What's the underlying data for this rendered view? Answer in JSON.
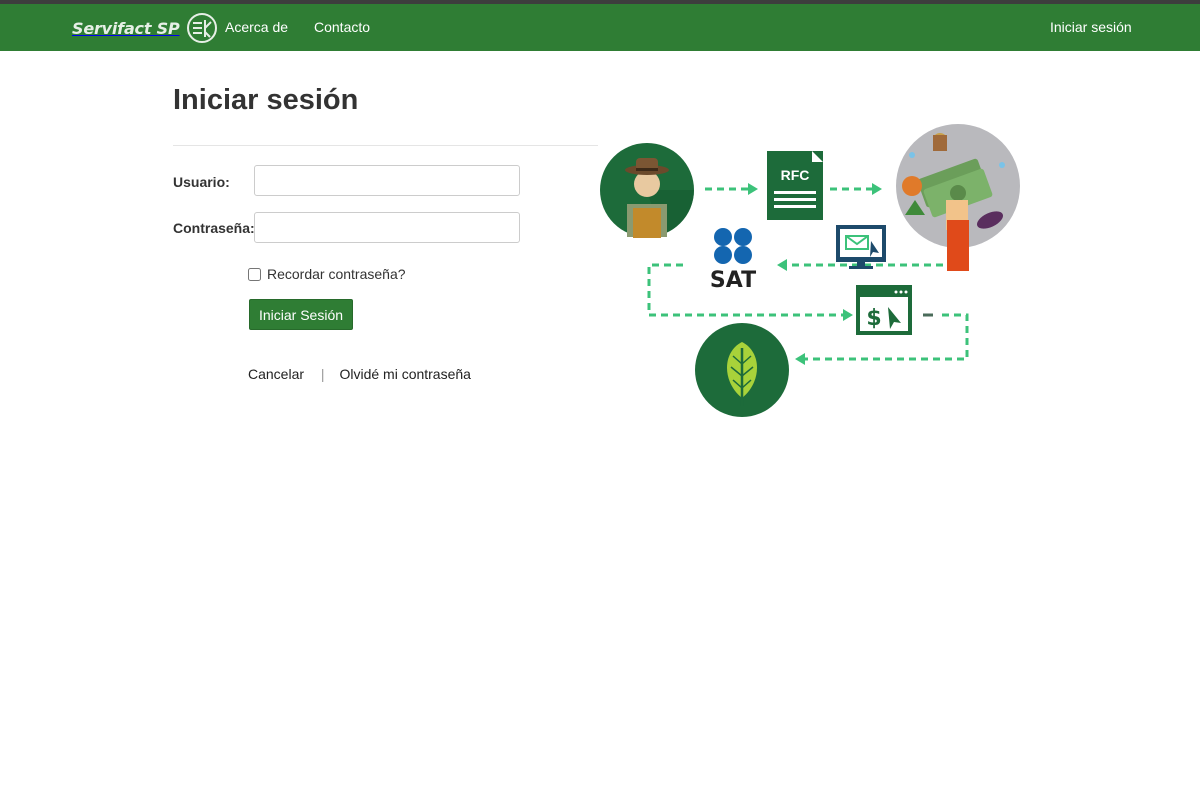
{
  "navbar": {
    "brand": "Servifact SP",
    "links": {
      "about": "Acerca de",
      "contact": "Contacto",
      "login": "Iniciar sesión"
    }
  },
  "page": {
    "title": "Iniciar sesión"
  },
  "form": {
    "username_label": "Usuario:",
    "username_value": "",
    "password_label": "Contraseña:",
    "password_value": "",
    "remember_label": "Recordar contraseña?",
    "remember_checked": false,
    "submit_label": "Iniciar Sesión",
    "cancel_label": "Cancelar",
    "separator": "|",
    "forgot_label": "Olvidé mi contraseña"
  },
  "illustration": {
    "rfc_text": "RFC",
    "sat_text": "SAT",
    "dollar_text": "$"
  },
  "colors": {
    "nav_green": "#2f7d34",
    "dark_green": "#1d6b3a",
    "arrow_green": "#3cc27a",
    "sat_blue": "#1466b0",
    "white": "#ffffff"
  }
}
